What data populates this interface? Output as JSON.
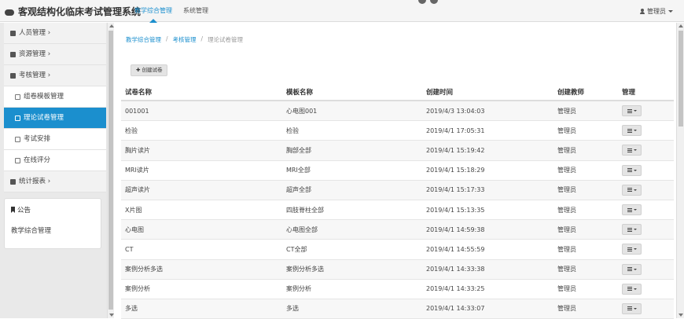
{
  "header": {
    "app_title": "客观结构化临床考试管理系统",
    "nav": [
      {
        "label": "教学综合管理",
        "active": true
      },
      {
        "label": "系统管理",
        "active": false
      }
    ],
    "user_label": "管理员"
  },
  "sidebar": {
    "items": [
      {
        "label": "人员管理 ›",
        "type": "parent"
      },
      {
        "label": "资源管理 ›",
        "type": "parent"
      },
      {
        "label": "考核管理 ›",
        "type": "parent"
      },
      {
        "label": "组卷模板管理",
        "type": "child"
      },
      {
        "label": "理论试卷管理",
        "type": "child",
        "active": true
      },
      {
        "label": "考试安排",
        "type": "child"
      },
      {
        "label": "在线评分",
        "type": "child"
      },
      {
        "label": "统计报表 ›",
        "type": "parent"
      }
    ],
    "notice_title": "公告",
    "notice_body": "教学综合管理"
  },
  "breadcrumb": {
    "items": [
      "教学综合管理",
      "考核管理",
      "理论试卷管理"
    ],
    "separator": "/"
  },
  "toolbar": {
    "create_label": "创建试卷",
    "create_icon": "plus-icon"
  },
  "table": {
    "headers": [
      "试卷名称",
      "模板名称",
      "创建时间",
      "创建教师",
      "管理"
    ],
    "rows": [
      [
        "001001",
        "心电图001",
        "2019/4/3 13:04:03",
        "管理员"
      ],
      [
        "检验",
        "检验",
        "2019/4/1 17:05:31",
        "管理员"
      ],
      [
        "胸片读片",
        "胸部全部",
        "2019/4/1 15:19:42",
        "管理员"
      ],
      [
        "MRI读片",
        "MRI全部",
        "2019/4/1 15:18:29",
        "管理员"
      ],
      [
        "超声读片",
        "超声全部",
        "2019/4/1 15:17:33",
        "管理员"
      ],
      [
        "X片图",
        "四肢脊柱全部",
        "2019/4/1 15:13:35",
        "管理员"
      ],
      [
        "心电图",
        "心电图全部",
        "2019/4/1 14:59:38",
        "管理员"
      ],
      [
        "CT",
        "CT全部",
        "2019/4/1 14:55:59",
        "管理员"
      ],
      [
        "案例分析多选",
        "案例分析多选",
        "2019/4/1 14:33:38",
        "管理员"
      ],
      [
        "案例分析",
        "案例分析",
        "2019/4/1 14:33:25",
        "管理员"
      ],
      [
        "多选",
        "多选",
        "2019/4/1 14:33:07",
        "管理员"
      ]
    ],
    "manage_icon": "menu-dropdown-icon"
  },
  "colors": {
    "accent": "#1b8fce",
    "sidebar_bg": "#e9e9e9",
    "topbar_bg": "#f5f5f5"
  }
}
